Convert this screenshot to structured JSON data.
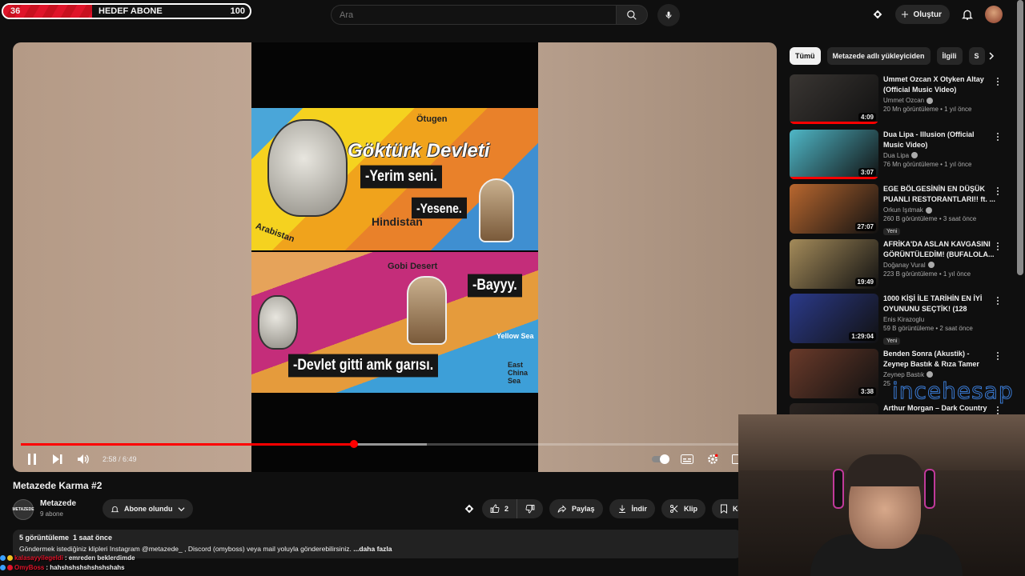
{
  "goal": {
    "current": "36",
    "title": "HEDEF ABONE",
    "target": "100",
    "progress_fraction": 0.36
  },
  "search": {
    "placeholder": "Ara"
  },
  "header": {
    "create_label": "Oluştur"
  },
  "player": {
    "time": "2:58 / 6:49",
    "played_fraction": 0.441,
    "buffered_fraction": 0.537,
    "video": {
      "title_overlay": "Göktürk Devleti",
      "labels": [
        "Ötugen",
        "Hindistan",
        "Arabistan",
        "Gobi Desert",
        "Yellow Sea",
        "East China Sea"
      ],
      "subtitles": [
        "-Yerim seni.",
        "-Yesene.",
        "-Bayyy.",
        "-Devlet gitti amk garısı."
      ]
    }
  },
  "video": {
    "title": "Metazede Karma #2",
    "channel": "Metazede",
    "channel_avatar_text": "METAZEDE",
    "subscribers": "9 abone",
    "subscribed_label": "Abone olundu",
    "likes": "2",
    "share": "Paylaş",
    "download": "İndir",
    "clip": "Klip",
    "save": "Kayd"
  },
  "description": {
    "views": "5 görüntüleme",
    "posted": "1 saat önce",
    "text": "Göndermek istediğiniz klipleri Instagram @metazede_ , Discord (omyboss) veya mail yoluyla gönderebilirsiniz.",
    "more": "...daha fazla"
  },
  "chat": [
    {
      "user": "kalasayyilegeldi",
      "message": ": emreden beklerdimde",
      "color": "#e0142a"
    },
    {
      "user": "OmyBoss",
      "message": ": hahshshshshshshshahs",
      "color": "#e0142a"
    }
  ],
  "chips": [
    "Tümü",
    "Metazede adlı yükleyiciden",
    "İlgili",
    "S"
  ],
  "recommendations": [
    {
      "title": "Ummet Ozcan X Otyken   Altay (Official Music Video)",
      "channel": "Ummet Ozcan",
      "verified": true,
      "meta": "20 Mn görüntüleme • 1 yıl önce",
      "duration": "4:09",
      "watched": 1.0,
      "new": "",
      "thumb": "#3a3633"
    },
    {
      "title": "Dua Lipa - Illusion (Official Music Video)",
      "channel": "Dua Lipa",
      "verified": true,
      "meta": "76 Mn görüntüleme • 1 yıl önce",
      "duration": "3:07",
      "watched": 1.0,
      "new": "",
      "thumb": "#4fb7c7"
    },
    {
      "title": "EGE BÖLGESİNİN EN DÜŞÜK PUANLI RESTORANTLARI!! ft. ...",
      "channel": "Orkun Işıtmak",
      "verified": true,
      "meta": "260 B görüntüleme • 3 saat önce",
      "duration": "27:07",
      "watched": 0,
      "new": "Yeni",
      "thumb": "#b8672f"
    },
    {
      "title": "AFRİKA'DA ASLAN KAVGASINI GÖRÜNTÜLEDİM! (BUFALOLA...",
      "channel": "Doğanay Vural",
      "verified": true,
      "meta": "223 B görüntüleme • 1 yıl önce",
      "duration": "19:49",
      "watched": 0,
      "new": "",
      "thumb": "#a48b5a"
    },
    {
      "title": "1000 KİŞİ İLE TARİHİN EN İYİ OYUNUNU SEÇTİK! (128 OYUN...",
      "channel": "Enis Kirazoglu",
      "verified": false,
      "meta": "59 B görüntüleme • 2 saat önce",
      "duration": "1:29:04",
      "watched": 0,
      "new": "Yeni",
      "thumb": "#2b3a8a"
    },
    {
      "title": "Benden Sonra (Akustik) - Zeynep Bastık & Rıza Tamer",
      "channel": "Zeynep Bastık",
      "verified": true,
      "meta": "25",
      "duration": "3:38",
      "watched": 0,
      "new": "",
      "thumb": "#6a3a2a"
    },
    {
      "title": "Arthur Morgan – Dark Country",
      "channel": "",
      "verified": false,
      "meta": "",
      "duration": "",
      "watched": 0,
      "new": "",
      "thumb": "#2a2320"
    }
  ],
  "watermark": "incehesap",
  "colors": {
    "accent": "#ff0000",
    "background": "#0f0f0f",
    "surface": "#272727"
  }
}
